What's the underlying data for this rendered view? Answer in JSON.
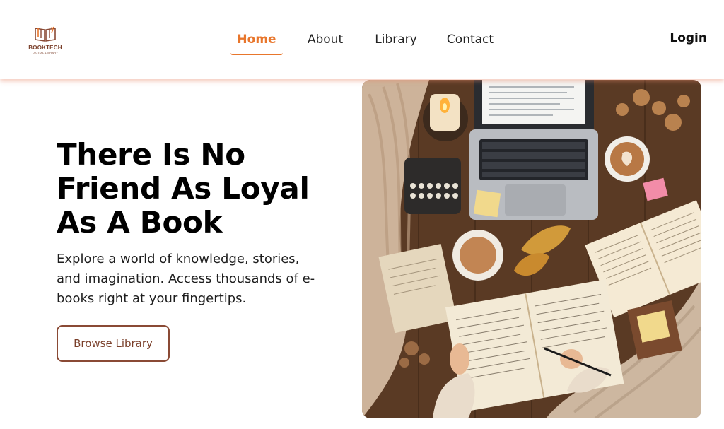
{
  "logo": {
    "icon": "open-book-logo-icon",
    "name": "BOOKTECH",
    "tagline": "DIGITAL LIBRARY"
  },
  "nav": {
    "items": [
      {
        "label": "Home",
        "active": true
      },
      {
        "label": "About",
        "active": false
      },
      {
        "label": "Library",
        "active": false
      },
      {
        "label": "Contact",
        "active": false
      }
    ],
    "login_label": "Login"
  },
  "hero": {
    "headline_line1": "There Is No",
    "headline_line2": "Friend As Loyal",
    "headline_line3": "As A Book",
    "subtext": "Explore a world of knowledge, stories, and imagination. Access thousands of e-books right at your fingertips.",
    "button_label": "Browse Library",
    "image": "desk-with-laptop-books-coffee-photo"
  },
  "colors": {
    "accent": "#e8762c",
    "brand_brown": "#8a4a35",
    "nav_shadow": "#f0a890"
  }
}
